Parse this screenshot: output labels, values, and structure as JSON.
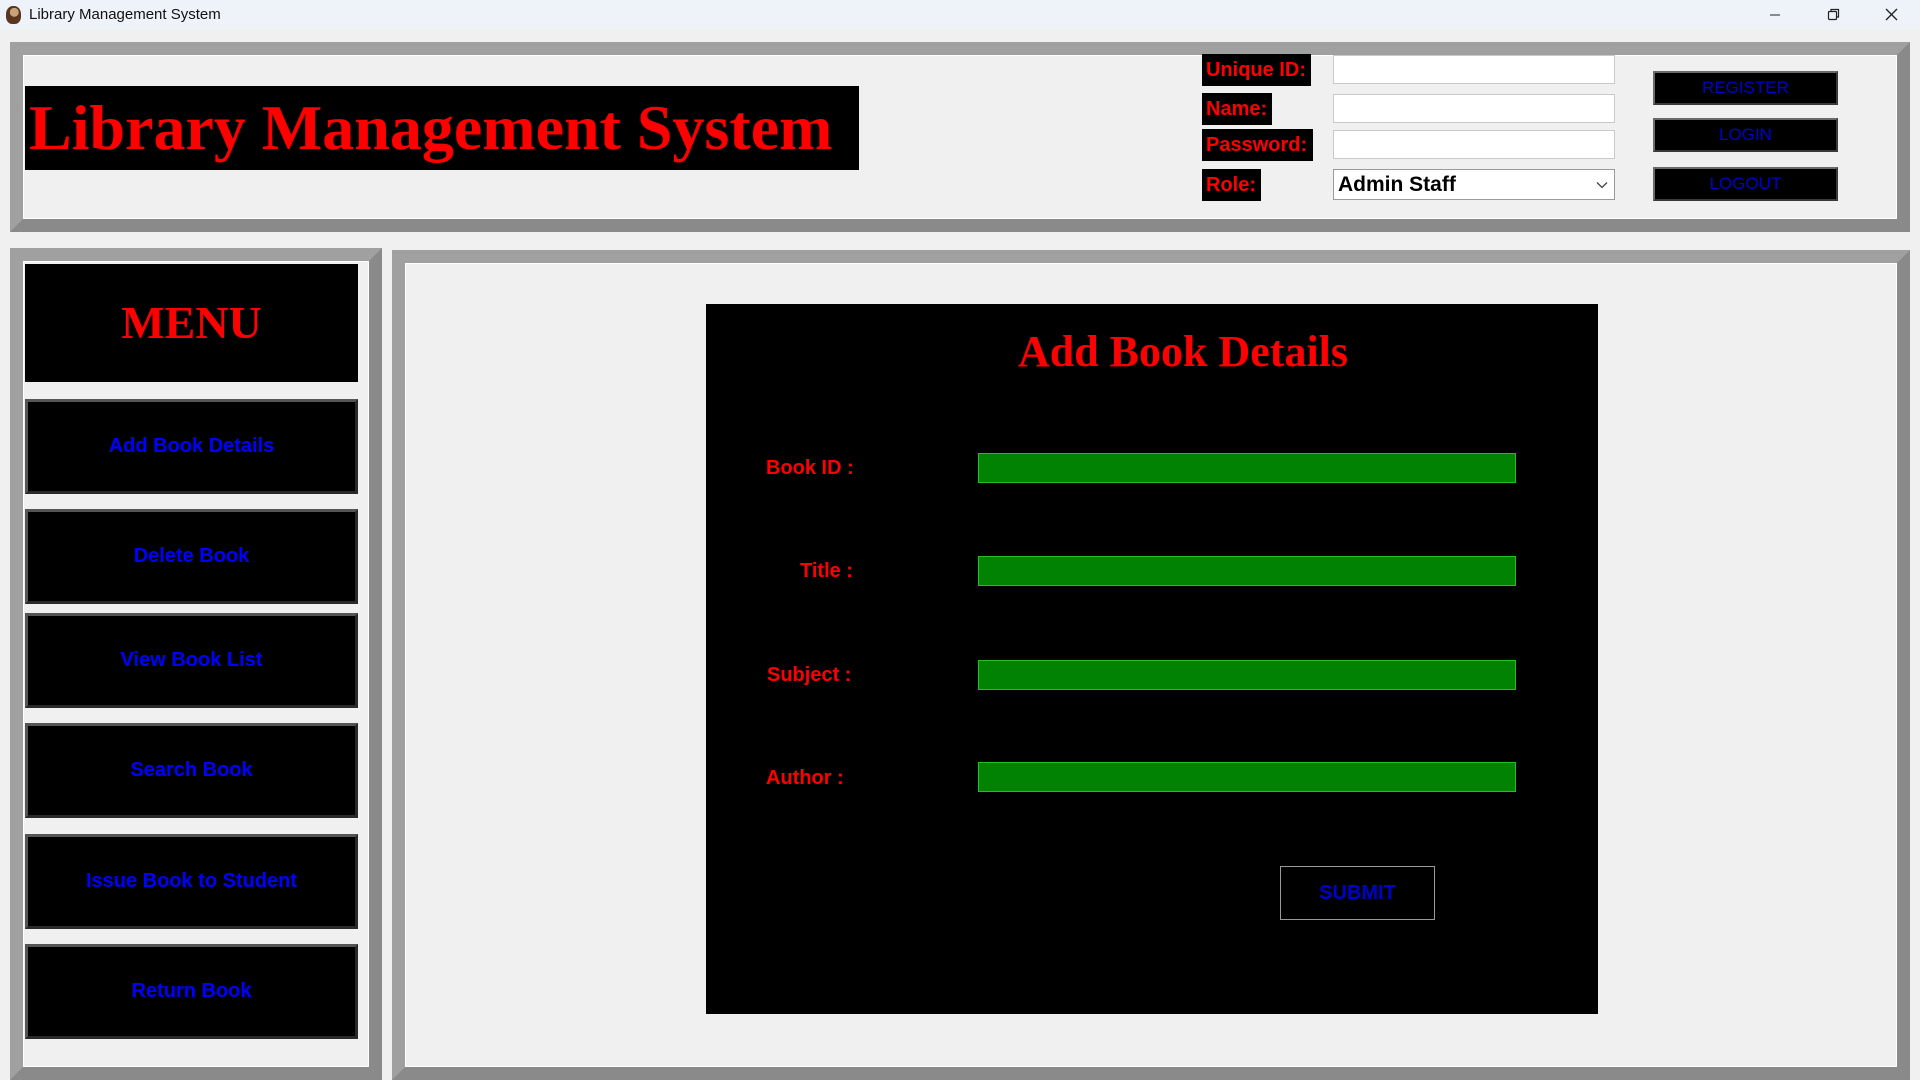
{
  "window": {
    "title": "Library Management System",
    "controls": [
      "minimize-icon",
      "restore-icon",
      "close-icon"
    ]
  },
  "header": {
    "app_title": "Library Management System",
    "labels": {
      "unique_id": "Unique ID:",
      "name": "Name:",
      "password": "Password:",
      "role": "Role:"
    },
    "values": {
      "unique_id": "",
      "name": "",
      "password": ""
    },
    "role_selected": "Admin Staff",
    "buttons": {
      "register": "REGISTER",
      "login": "LOGIN",
      "logout": "LOGOUT"
    }
  },
  "menu": {
    "title": "MENU",
    "items": [
      {
        "label": "Add Book Details"
      },
      {
        "label": "Delete Book"
      },
      {
        "label": "View Book List"
      },
      {
        "label": "Search Book"
      },
      {
        "label": "Issue Book to Student"
      },
      {
        "label": "Return Book"
      }
    ]
  },
  "form": {
    "title": "Add Book Details",
    "fields": [
      {
        "label": "Book ID :",
        "value": ""
      },
      {
        "label": "Title :",
        "value": ""
      },
      {
        "label": "Subject :",
        "value": ""
      },
      {
        "label": "Author :",
        "value": ""
      }
    ],
    "submit": "SUBMIT"
  },
  "colors": {
    "label_text": "#ff0000",
    "button_text": "#0000ff",
    "panel_bg": "#000000",
    "entry_green": "#028202",
    "frame_gray": "#a0a0a0"
  }
}
